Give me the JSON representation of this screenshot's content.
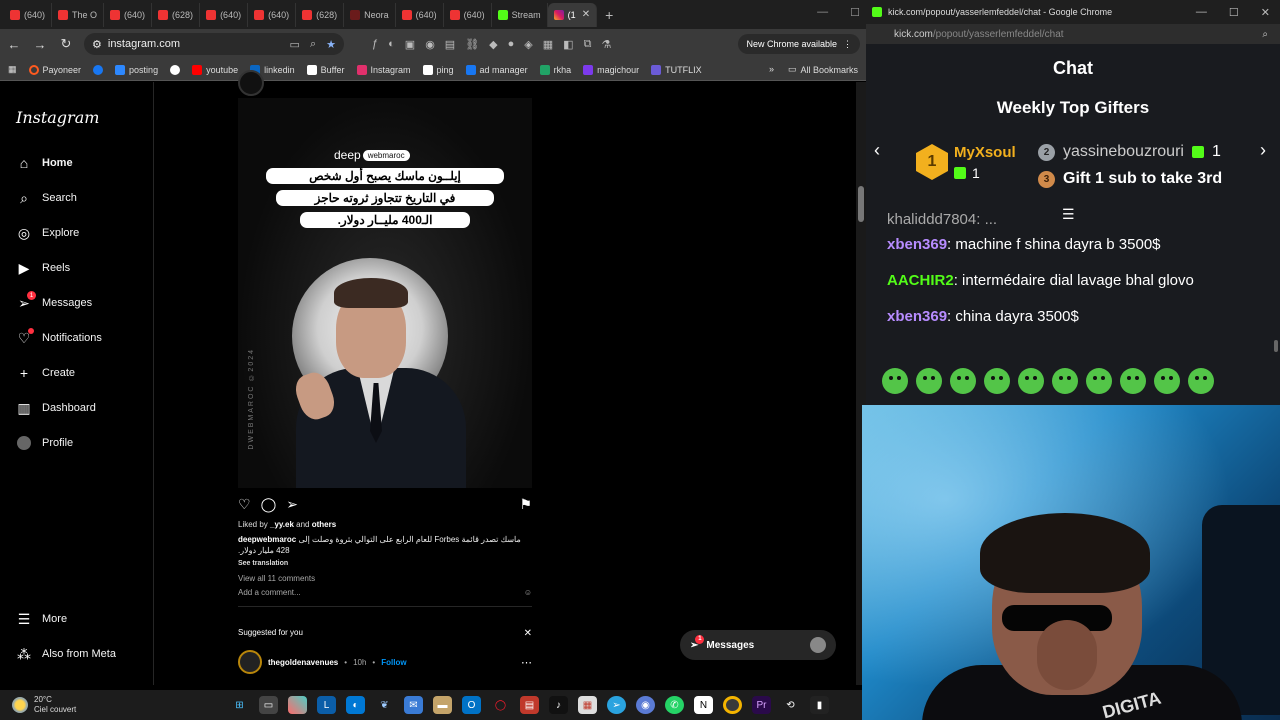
{
  "left_window": {
    "tabs": [
      {
        "label": "(640)"
      },
      {
        "label": "The O"
      },
      {
        "label": "(640)"
      },
      {
        "label": "(628)"
      },
      {
        "label": "(640)"
      },
      {
        "label": "(640)"
      },
      {
        "label": "(628)"
      },
      {
        "label": "Neora"
      },
      {
        "label": "(640)"
      },
      {
        "label": "(640)"
      },
      {
        "label": "Stream"
      },
      {
        "label": "(1"
      }
    ],
    "url": "instagram.com",
    "new_chrome": "New Chrome available",
    "bookmarks": [
      {
        "label": "Payoneer",
        "color": "#ff5a1f"
      },
      {
        "label": "",
        "color": "#1877f2"
      },
      {
        "label": "posting",
        "color": "#2d88ff"
      },
      {
        "label": "",
        "color": "#ffffff"
      },
      {
        "label": "youtube",
        "color": "#ff0000"
      },
      {
        "label": "linkedin",
        "color": "#0a66c2"
      },
      {
        "label": "Buffer",
        "color": "#ffffff"
      },
      {
        "label": "Instagram",
        "color": "#e1306c"
      },
      {
        "label": "ping",
        "color": "#ffffff"
      },
      {
        "label": "ad manager",
        "color": "#1877f2"
      },
      {
        "label": "rkha",
        "color": "#21a366"
      },
      {
        "label": "magichour",
        "color": "#7c3aed"
      },
      {
        "label": "TUTFLIX",
        "color": "#6b5bd6"
      }
    ],
    "all_bookmarks": "All Bookmarks"
  },
  "instagram": {
    "logo": "Instagram",
    "nav": [
      {
        "label": "Home",
        "icon": "home-icon"
      },
      {
        "label": "Search",
        "icon": "search-icon"
      },
      {
        "label": "Explore",
        "icon": "explore-icon"
      },
      {
        "label": "Reels",
        "icon": "reels-icon"
      },
      {
        "label": "Messages",
        "icon": "messages-icon",
        "badge": "1"
      },
      {
        "label": "Notifications",
        "icon": "heart-icon"
      },
      {
        "label": "Create",
        "icon": "plus-icon"
      },
      {
        "label": "Dashboard",
        "icon": "dashboard-icon"
      },
      {
        "label": "Profile",
        "icon": "profile-icon"
      }
    ],
    "more": "More",
    "also_from_meta": "Also from Meta",
    "post": {
      "brand": "deep",
      "brand_pill": "webmaroc",
      "headline": [
        "إيلــون ماسك يصبح أول شخص",
        "في التاريخ تتجاوز ثروته حاجز",
        "الـ400 مليــار دولار."
      ],
      "watermark": "DWEBMAROC ©2024",
      "liked_by_prefix": "Liked by",
      "liked_by_user": "_yy.ek",
      "liked_by_and": "and",
      "liked_by_others": "others",
      "caption_user": "deepwebmaroc",
      "caption_text": "ماسك تصدر قائمة Forbes للعام الرابع على التوالي بثروة وصلت إلى 428 مليار دولار.",
      "see_translation": "See translation",
      "view_comments": "View all 11 comments",
      "add_comment": "Add a comment...",
      "suggested_for_you": "Suggested for you",
      "suggested_user": "thegoldenavenues",
      "suggested_time": "10h",
      "follow": "Follow"
    },
    "messages_pill": {
      "label": "Messages",
      "badge": "1"
    }
  },
  "right_window": {
    "title": "kick.com/popout/yasserlemfeddel/chat - Google Chrome",
    "url_host": "kick.com",
    "url_path": "/popout/yasserlemfeddel/chat",
    "chat_title": "Chat",
    "gifters_title": "Weekly Top Gifters",
    "gifters": [
      {
        "rank": "1",
        "name": "MyXsoul",
        "count": "1"
      },
      {
        "rank": "2",
        "name": "yassinebouzrouri",
        "count": "1"
      },
      {
        "rank": "3",
        "name": "Gift 1 sub to take 3rd"
      }
    ],
    "chat_cut_text": "khaliddd7804: ...",
    "chat_messages": [
      {
        "user": "xben369",
        "color": "#b78cff",
        "text": " machine f shina dayra b 3500$"
      },
      {
        "user": "AACHIR2",
        "color": "#53fc18",
        "text": " intermédaire dial lavage bhal glovo"
      },
      {
        "user": "xben369",
        "color": "#b78cff",
        "text": " china dayra 3500$"
      }
    ]
  },
  "webcam": {
    "shirt_text": "DIGITA"
  },
  "taskbar": {
    "temp": "20°C",
    "condition": "Ciel couvert"
  }
}
